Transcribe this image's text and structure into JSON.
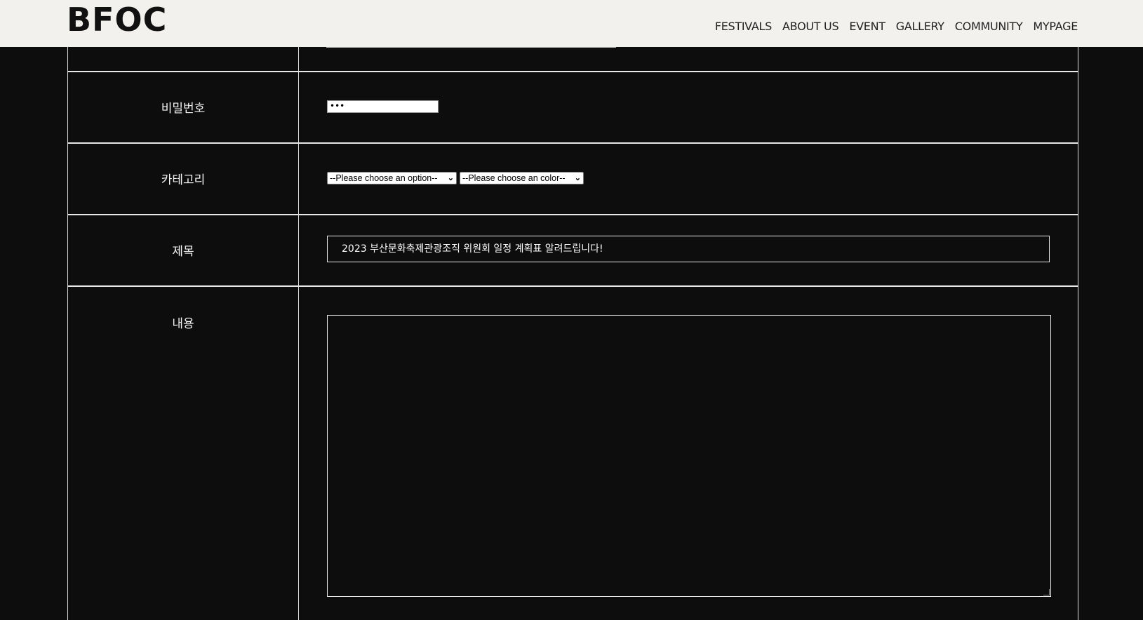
{
  "header": {
    "logo": "BFOC",
    "nav": [
      "FESTIVALS",
      "ABOUT US",
      "EVENT",
      "GALLERY",
      "COMMUNITY",
      "MYPAGE"
    ]
  },
  "form": {
    "password": {
      "label": "비밀번호",
      "value": "•••"
    },
    "category": {
      "label": "카테고리",
      "select1": "--Please choose an option--",
      "select2": "--Please choose an color--"
    },
    "title": {
      "label": "제목",
      "value": "2023 부산문화축제관광조직 위원회 일정 계획표 알려드립니다!"
    },
    "content": {
      "label": "내용",
      "value": ""
    }
  },
  "colors": {
    "background": "#0d0d0d",
    "header_bg": "#f2f1ee",
    "border": "#e8e8e8"
  }
}
